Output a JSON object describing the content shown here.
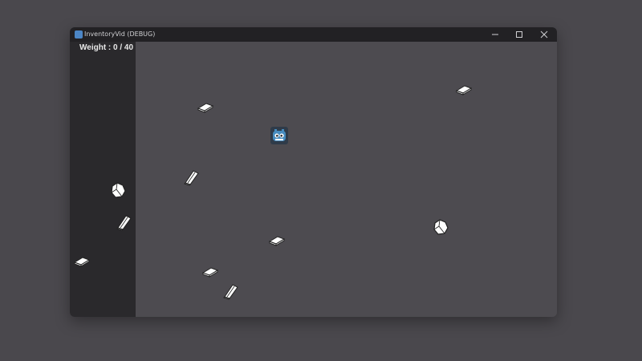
{
  "window": {
    "title": "InventoryVid (DEBUG)",
    "controls": {
      "minimize_icon": "minimize-icon",
      "maximize_icon": "maximize-icon",
      "close_icon": "close-icon"
    }
  },
  "hud": {
    "weight_label": "Weight : 0 / 40"
  },
  "colors": {
    "desktop": "#4a484d",
    "game_background": "#4d4b50",
    "side_panel": "#2a292c",
    "titlebar": "#222124",
    "godot_blue": "#478cbf"
  },
  "items": {
    "ingot_icon": "metal-ingot-icon",
    "rock_icon": "rock-ore-icon",
    "player_icon": "godot-player-icon"
  }
}
